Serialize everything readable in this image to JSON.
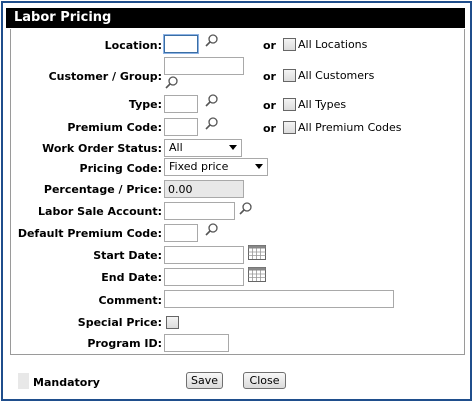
{
  "title": "Labor Pricing",
  "or_label": "or",
  "fields": {
    "location": {
      "label": "Location:",
      "value": "",
      "check_label": "All Locations"
    },
    "customer_group": {
      "label": "Customer / Group:",
      "value": "",
      "check_label": "All Customers"
    },
    "type": {
      "label": "Type:",
      "value": "",
      "check_label": "All Types"
    },
    "premium_code": {
      "label": "Premium Code:",
      "value": "",
      "check_label": "All Premium Codes"
    },
    "work_order_status": {
      "label": "Work Order Status:",
      "value": "All"
    },
    "pricing_code": {
      "label": "Pricing Code:",
      "value": "Fixed price"
    },
    "percentage_price": {
      "label": "Percentage / Price:",
      "value": "0.00"
    },
    "labor_sale_account": {
      "label": "Labor Sale Account:",
      "value": ""
    },
    "default_premium_code": {
      "label": "Default Premium Code:",
      "value": ""
    },
    "start_date": {
      "label": "Start Date:",
      "value": ""
    },
    "end_date": {
      "label": "End Date:",
      "value": ""
    },
    "comment": {
      "label": "Comment:",
      "value": ""
    },
    "special_price": {
      "label": "Special Price:"
    },
    "program_id": {
      "label": "Program ID:",
      "value": ""
    }
  },
  "footer": {
    "mandatory_label": "Mandatory",
    "save_label": "Save",
    "close_label": "Close"
  },
  "icons": {
    "lookup": "magnifier-icon",
    "calendar": "calendar-icon"
  }
}
